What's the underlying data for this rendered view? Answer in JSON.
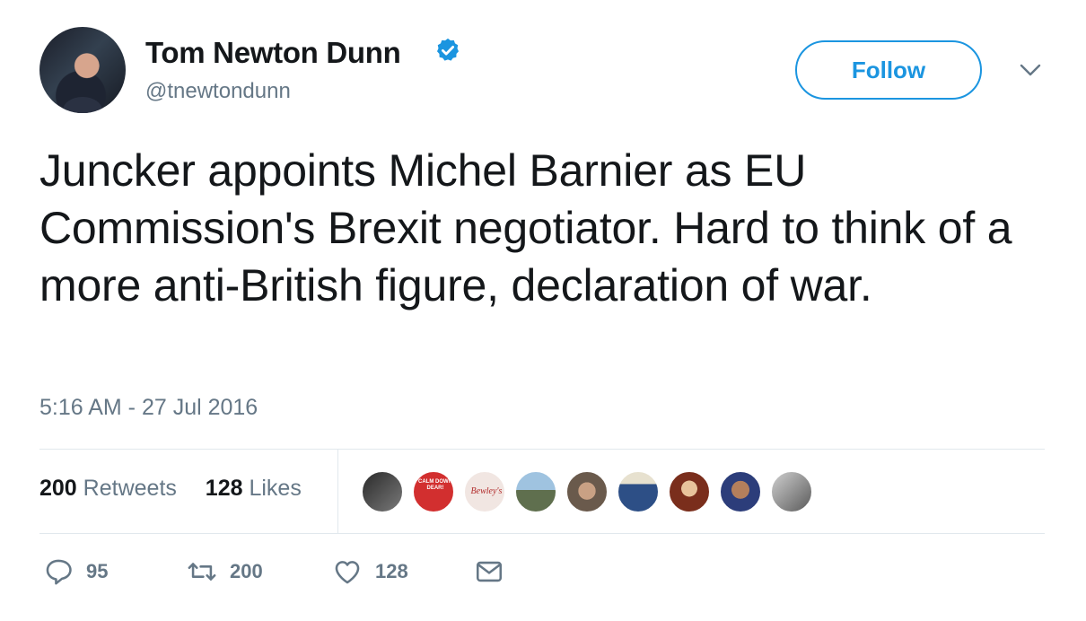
{
  "author": {
    "name": "Tom Newton Dunn",
    "handle": "@tnewtondunn"
  },
  "follow_label": "Follow",
  "tweet": {
    "text": "Juncker appoints Michel Barnier as EU Commission's Brexit negotiator. Hard to think of a more anti-British figure, declaration of war.",
    "timestamp": "5:16 AM - 27 Jul 2016"
  },
  "stats": {
    "retweets_count": "200",
    "retweets_label": "Retweets",
    "likes_count": "128",
    "likes_label": "Likes"
  },
  "liker_avatars": [
    {
      "name": "liker-avatar-1"
    },
    {
      "name": "liker-avatar-2",
      "text": "CALM DOWN DEAR!"
    },
    {
      "name": "liker-avatar-3",
      "text": "Bewley's"
    },
    {
      "name": "liker-avatar-4"
    },
    {
      "name": "liker-avatar-5"
    },
    {
      "name": "liker-avatar-6"
    },
    {
      "name": "liker-avatar-7"
    },
    {
      "name": "liker-avatar-8"
    },
    {
      "name": "liker-avatar-9"
    }
  ],
  "actions": {
    "reply_count": "95",
    "retweet_count": "200",
    "like_count": "128"
  },
  "colors": {
    "accent": "#1b95e0",
    "muted": "#657786",
    "text": "#14171a",
    "divider": "#e1e8ed"
  },
  "icons": [
    "verified-badge-icon",
    "chevron-down-icon",
    "reply-icon",
    "retweet-icon",
    "heart-icon",
    "envelope-icon"
  ]
}
